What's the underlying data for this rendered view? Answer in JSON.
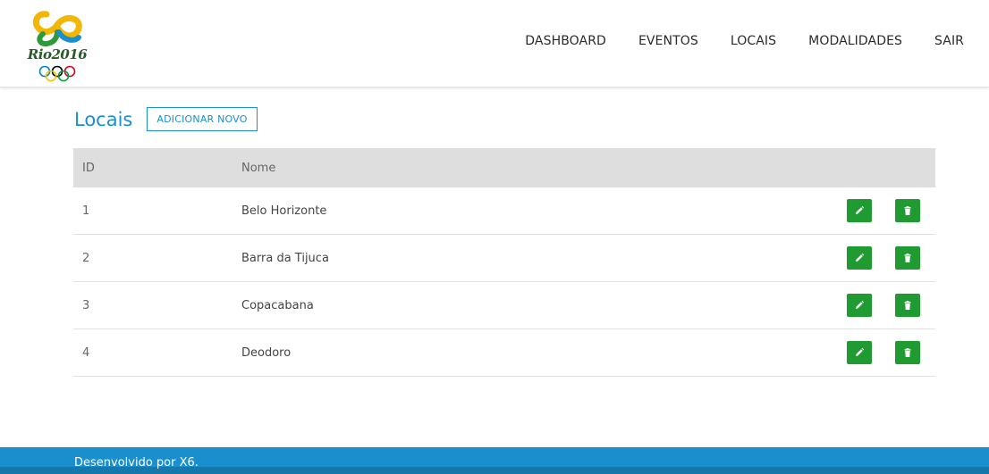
{
  "logo": {
    "text": "Rio2016",
    "icon": "olympic-rings-icon"
  },
  "nav": {
    "items": [
      {
        "label": "DASHBOARD"
      },
      {
        "label": "EVENTOS"
      },
      {
        "label": "LOCAIS"
      },
      {
        "label": "MODALIDADES"
      },
      {
        "label": "SAIR"
      }
    ]
  },
  "page": {
    "title": "Locais",
    "add_label": "ADICIONAR NOVO"
  },
  "table": {
    "columns": {
      "id": "ID",
      "name": "Nome"
    },
    "rows": [
      {
        "id": "1",
        "name": "Belo Horizonte"
      },
      {
        "id": "2",
        "name": "Barra da Tijuca"
      },
      {
        "id": "3",
        "name": "Copacabana"
      },
      {
        "id": "4",
        "name": "Deodoro"
      }
    ],
    "action_icons": {
      "edit": "pencil-icon",
      "delete": "trash-icon"
    }
  },
  "footer": {
    "text": "Desenvolvido por X6."
  },
  "colors": {
    "accent": "#1a8fce",
    "action_green": "#1f9b32",
    "table_header": "#dedede"
  }
}
